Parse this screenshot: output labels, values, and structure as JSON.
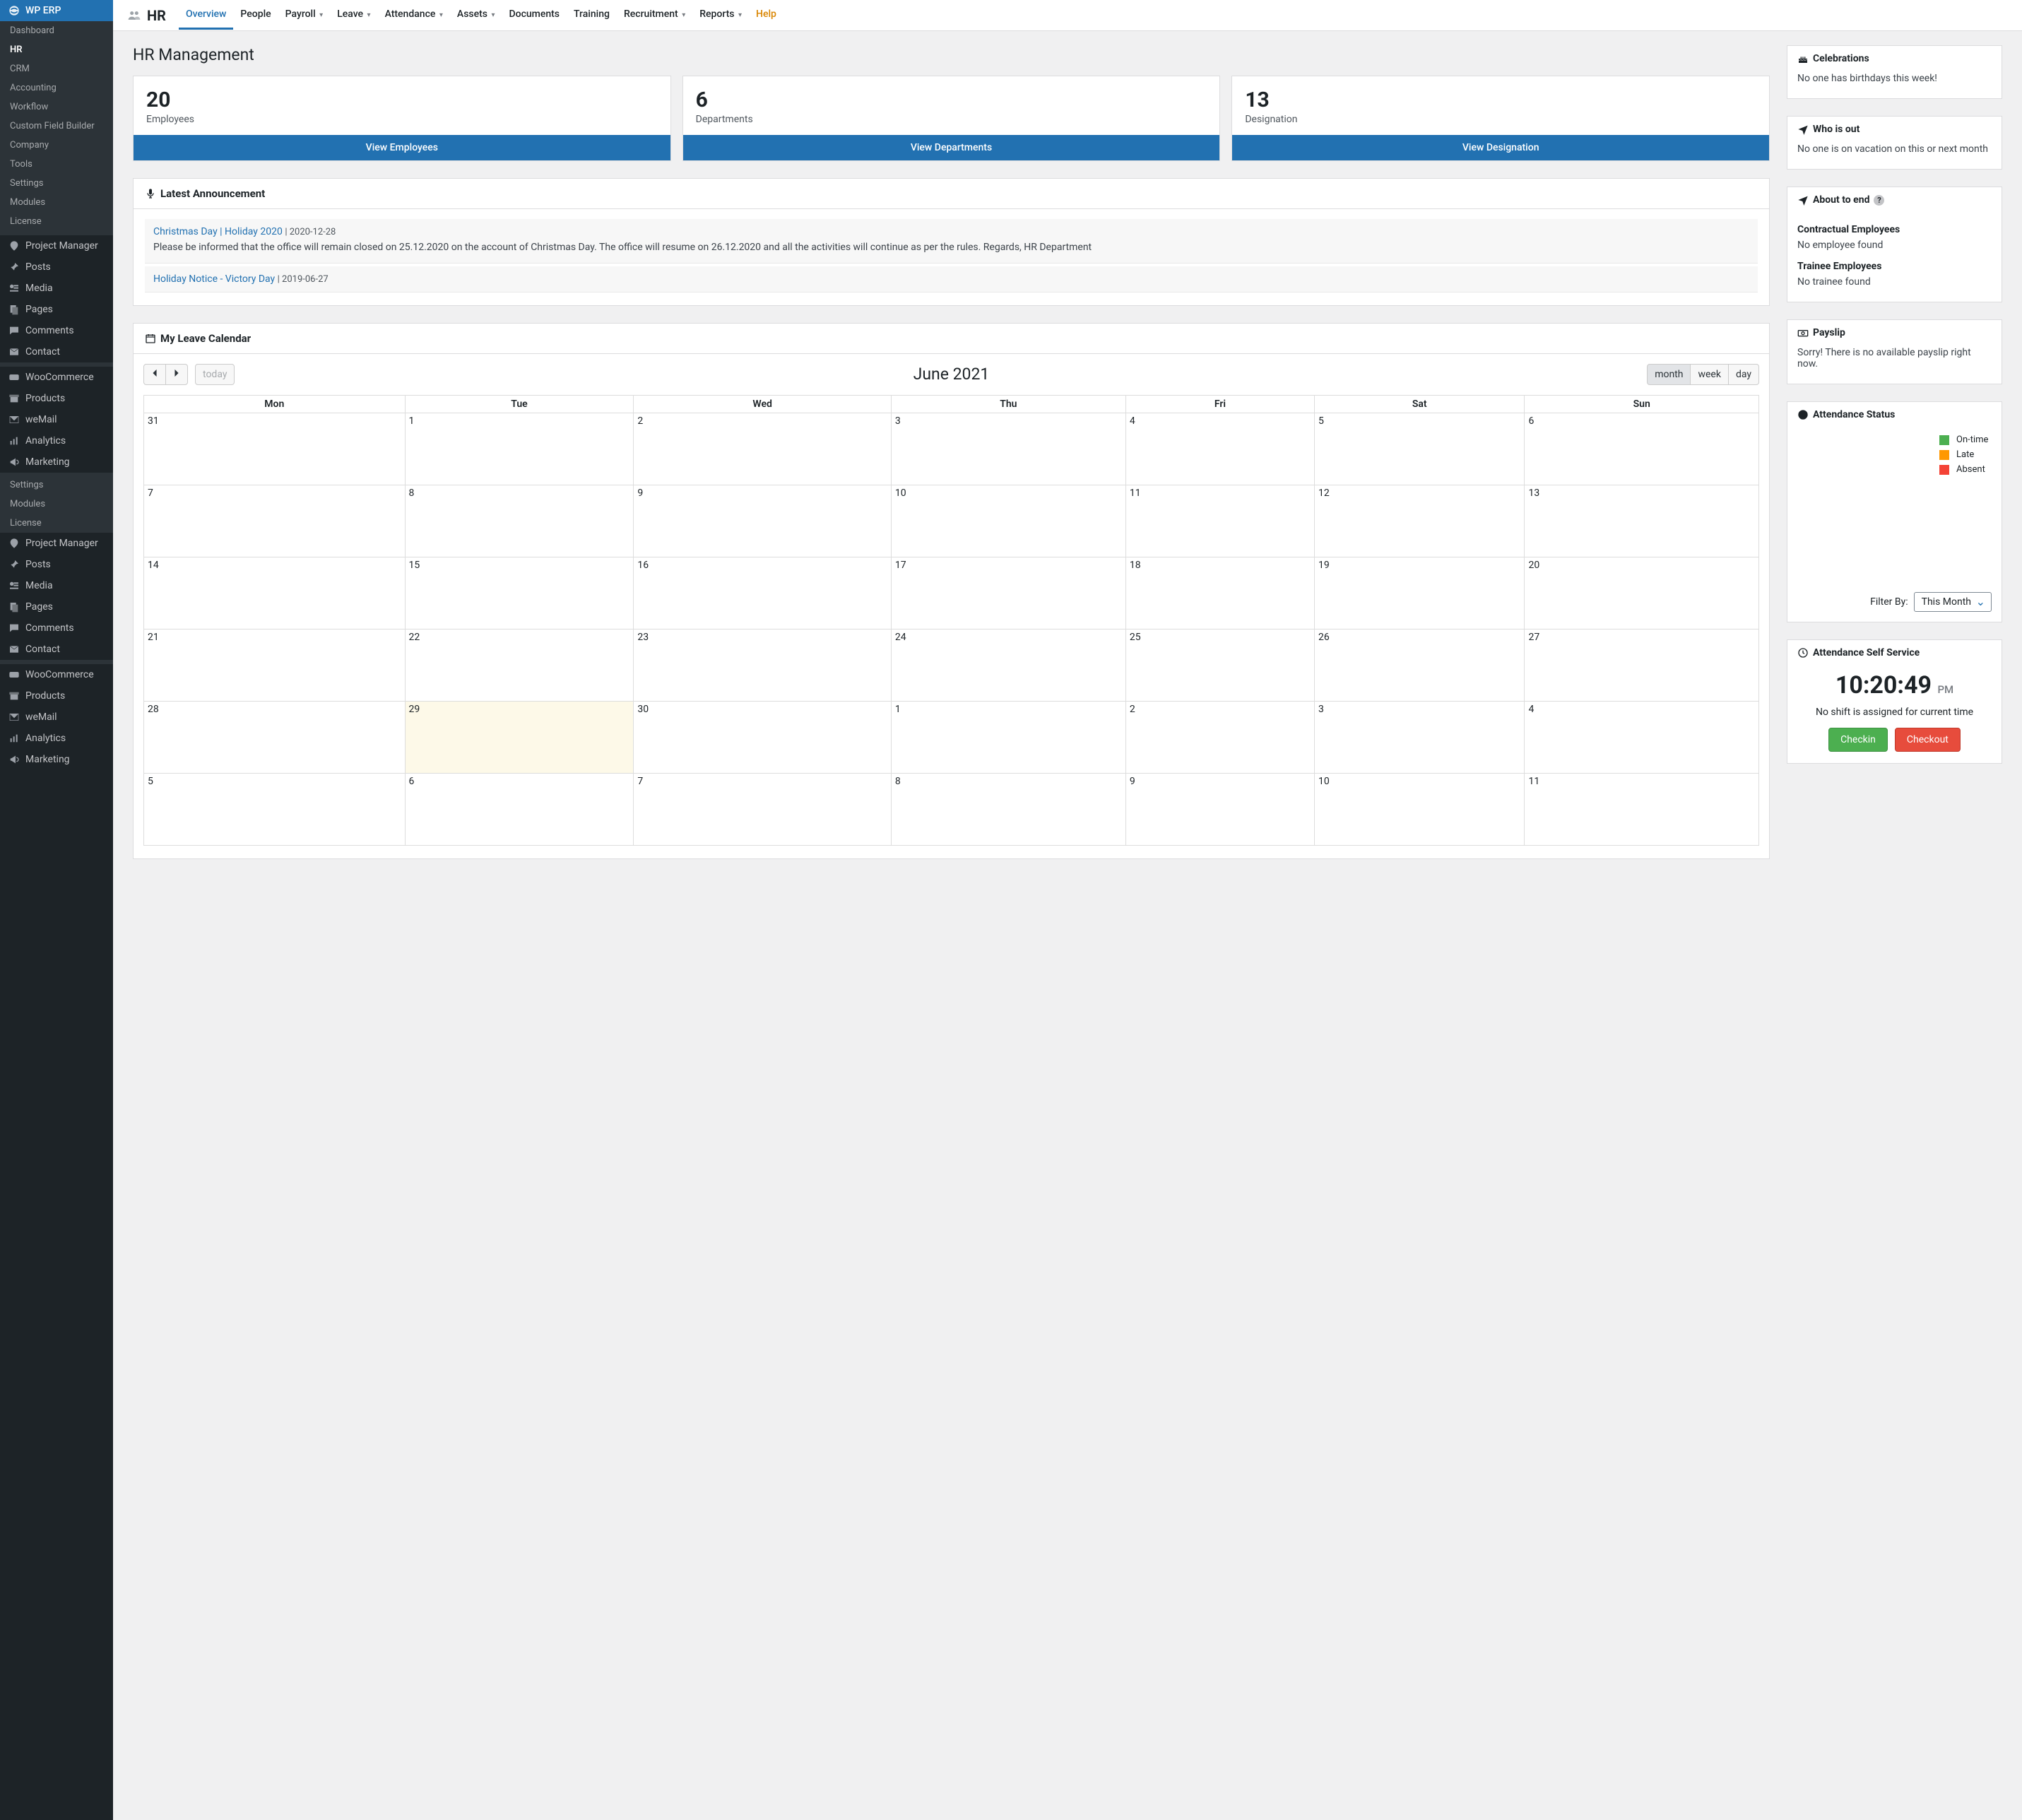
{
  "sidebar": {
    "brand": "WP ERP",
    "sub": [
      {
        "label": "Dashboard"
      },
      {
        "label": "HR",
        "current": true
      },
      {
        "label": "CRM"
      },
      {
        "label": "Accounting"
      },
      {
        "label": "Workflow"
      },
      {
        "label": "Custom Field Builder"
      },
      {
        "label": "Company"
      },
      {
        "label": "Tools"
      },
      {
        "label": "Settings"
      },
      {
        "label": "Modules"
      },
      {
        "label": "License"
      }
    ],
    "groupA": [
      {
        "label": "Project Manager",
        "icon": "pm"
      },
      {
        "label": "Posts",
        "icon": "pin"
      },
      {
        "label": "Media",
        "icon": "media"
      },
      {
        "label": "Pages",
        "icon": "page"
      },
      {
        "label": "Comments",
        "icon": "chat"
      },
      {
        "label": "Contact",
        "icon": "mail"
      }
    ],
    "groupB": [
      {
        "label": "WooCommerce",
        "icon": "woo"
      },
      {
        "label": "Products",
        "icon": "box"
      },
      {
        "label": "weMail",
        "icon": "wemail"
      },
      {
        "label": "Analytics",
        "icon": "chart"
      },
      {
        "label": "Marketing",
        "icon": "bullhorn"
      }
    ],
    "groupC": [
      {
        "label": "Settings"
      },
      {
        "label": "Modules"
      },
      {
        "label": "License"
      }
    ]
  },
  "topnav": {
    "brand": "HR",
    "items": [
      {
        "label": "Overview",
        "active": true
      },
      {
        "label": "People"
      },
      {
        "label": "Payroll",
        "dd": true
      },
      {
        "label": "Leave",
        "dd": true
      },
      {
        "label": "Attendance",
        "dd": true
      },
      {
        "label": "Assets",
        "dd": true
      },
      {
        "label": "Documents"
      },
      {
        "label": "Training"
      },
      {
        "label": "Recruitment",
        "dd": true
      },
      {
        "label": "Reports",
        "dd": true
      },
      {
        "label": "Help",
        "help": true
      }
    ]
  },
  "page_title": "HR Management",
  "stats": [
    {
      "num": "20",
      "label": "Employees",
      "button": "View Employees"
    },
    {
      "num": "6",
      "label": "Departments",
      "button": "View Departments"
    },
    {
      "num": "13",
      "label": "Designation",
      "button": "View Designation"
    }
  ],
  "announcement": {
    "title": "Latest Announcement",
    "items": [
      {
        "title": "Christmas Day | Holiday 2020",
        "date": "2020-12-28",
        "body": "Please be informed that the office will remain closed on 25.12.2020 on the account of Christmas Day. The office will resume on 26.12.2020 and all the activities will continue as per the rules. Regards, HR Department"
      },
      {
        "title": "Holiday Notice - Victory Day",
        "date": "2019-06-27"
      }
    ]
  },
  "calendar": {
    "title": "My Leave Calendar",
    "today_btn": "today",
    "month_label": "June 2021",
    "views": [
      "month",
      "week",
      "day"
    ],
    "active_view": "month",
    "dow": [
      "Mon",
      "Tue",
      "Wed",
      "Thu",
      "Fri",
      "Sat",
      "Sun"
    ],
    "weeks": [
      [
        "31",
        "1",
        "2",
        "3",
        "4",
        "5",
        "6"
      ],
      [
        "7",
        "8",
        "9",
        "10",
        "11",
        "12",
        "13"
      ],
      [
        "14",
        "15",
        "16",
        "17",
        "18",
        "19",
        "20"
      ],
      [
        "21",
        "22",
        "23",
        "24",
        "25",
        "26",
        "27"
      ],
      [
        "28",
        "29",
        "30",
        "1",
        "2",
        "3",
        "4"
      ],
      [
        "5",
        "6",
        "7",
        "8",
        "9",
        "10",
        "11"
      ]
    ],
    "today_cell": [
      4,
      1
    ]
  },
  "widgets": {
    "celebrations": {
      "title": "Celebrations",
      "body": "No one has birthdays this week!"
    },
    "whoisout": {
      "title": "Who is out",
      "body": "No one is on vacation on this or next month"
    },
    "about_to_end": {
      "title": "About to end",
      "sections": [
        {
          "heading": "Contractual Employees",
          "body": "No employee found"
        },
        {
          "heading": "Trainee Employees",
          "body": "No trainee found"
        }
      ]
    },
    "payslip": {
      "title": "Payslip",
      "body": "Sorry! There is no available payslip right now."
    },
    "attendance_status": {
      "title": "Attendance Status",
      "legend": [
        {
          "label": "On-time",
          "color": "#4caf50"
        },
        {
          "label": "Late",
          "color": "#ff9800"
        },
        {
          "label": "Absent",
          "color": "#f44336"
        }
      ],
      "filter_label": "Filter By:",
      "filter_value": "This Month"
    },
    "self_service": {
      "title": "Attendance Self Service",
      "time": "10:20:49",
      "ampm": "PM",
      "note": "No shift is assigned for current time",
      "checkin": "Checkin",
      "checkout": "Checkout"
    }
  },
  "chart_data": {
    "type": "pie",
    "series": [
      {
        "name": "On-time",
        "value": 0,
        "color": "#4caf50"
      },
      {
        "name": "Late",
        "value": 0,
        "color": "#ff9800"
      },
      {
        "name": "Absent",
        "value": 0,
        "color": "#f44336"
      }
    ],
    "note": "No data rendered; only legend visible"
  }
}
